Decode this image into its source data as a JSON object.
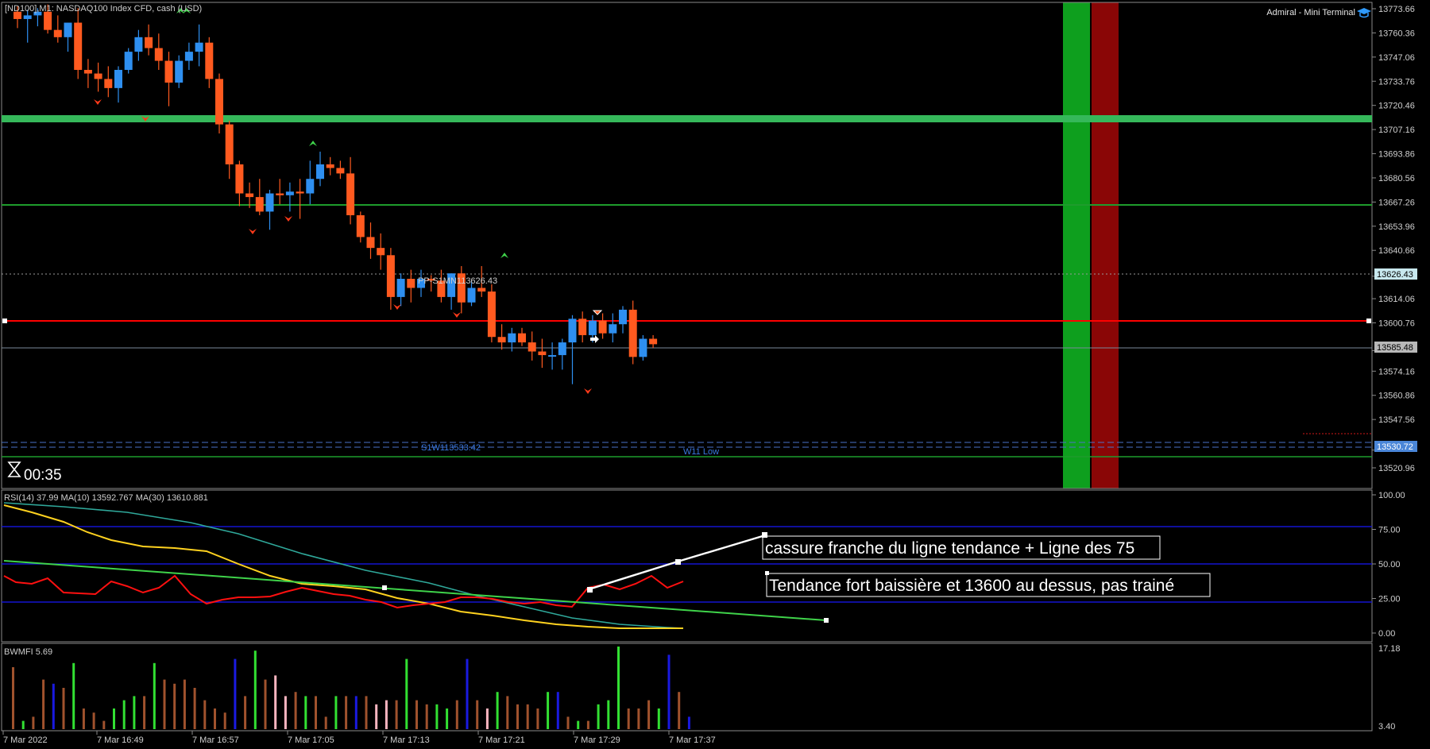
{
  "header": {
    "symbol_info": "[ND100],M1:  NASDAQ100 Index CFD, cash (USD)",
    "terminal_name": "Admiral - Mini Terminal"
  },
  "timer": {
    "value": "00:35"
  },
  "levels": {
    "pp": "PP-S1MN113626.43",
    "s1w": "S1W113533.42",
    "wl": "W11 Low"
  },
  "price_axis": {
    "labels": [
      "13773.66",
      "13760.36",
      "13747.06",
      "13733.76",
      "13720.46",
      "13707.16",
      "13693.86",
      "13680.56",
      "13667.26",
      "13653.96",
      "13640.66",
      "13626.43",
      "13614.06",
      "13600.76",
      "13585.48",
      "13574.16",
      "13560.86",
      "13547.56",
      "13530.72",
      "13520.96"
    ],
    "boxes": {
      "pivot": "13626.43",
      "current": "13585.48",
      "support": "13530.72"
    }
  },
  "rsi": {
    "title": "RSI(14) 37.99 MA(10) 13592.767 MA(30) 13610.881",
    "axis_labels": [
      "100.00",
      "75.00",
      "50.00",
      "25.00",
      "0.00"
    ]
  },
  "bwmfi": {
    "title": "BWMFI 5.69",
    "axis_labels": [
      "17.18",
      "3.40"
    ]
  },
  "annotations": {
    "note1": "cassure franche du ligne tendance + Ligne des 75",
    "note2": "Tendance fort baissière et 13600 au dessus, pas trainé"
  },
  "time_axis": [
    "7 Mar 2022",
    "7 Mar 16:49",
    "7 Mar 16:57",
    "7 Mar 17:05",
    "7 Mar 17:13",
    "7 Mar 17:21",
    "7 Mar 17:29",
    "7 Mar 17:37"
  ],
  "colors": {
    "bull": "#2e8ff0",
    "bear": "#ff5a1f",
    "resistance_line": "#ff0000",
    "rsi_line": "#ff1010",
    "ma_fast": "#ffd21f",
    "ma_slow": "#2fa89a",
    "trendline": "#3fd34a",
    "zone_green": "#0e9f1e",
    "zone_red": "#8a0606"
  },
  "chart_data": {
    "type": "candlestick",
    "series": [
      {
        "name": "",
        "ohlc": [
          [
            13772,
            13775,
            13763,
            13768
          ],
          [
            13768,
            13773,
            13755,
            13770
          ],
          [
            13770,
            13774,
            13764,
            13772
          ],
          [
            13772,
            13776,
            13760,
            13762
          ],
          [
            13762,
            13770,
            13755,
            13758
          ],
          [
            13758,
            13766,
            13750,
            13766
          ],
          [
            13766,
            13774,
            13735,
            13740
          ],
          [
            13740,
            13746,
            13730,
            13738
          ],
          [
            13738,
            13744,
            13728,
            13735
          ],
          [
            13735,
            13742,
            13725,
            13730
          ],
          [
            13730,
            13742,
            13722,
            13740
          ],
          [
            13740,
            13752,
            13738,
            13750
          ],
          [
            13750,
            13762,
            13745,
            13758
          ],
          [
            13758,
            13765,
            13748,
            13752
          ],
          [
            13752,
            13760,
            13740,
            13745
          ],
          [
            13745,
            13750,
            13720,
            13733
          ],
          [
            13733,
            13748,
            13730,
            13745
          ],
          [
            13745,
            13755,
            13740,
            13750
          ],
          [
            13750,
            13765,
            13742,
            13755
          ],
          [
            13755,
            13758,
            13730,
            13735
          ],
          [
            13735,
            13738,
            13705,
            13710
          ],
          [
            13710,
            13712,
            13680,
            13688
          ],
          [
            13688,
            13690,
            13665,
            13672
          ],
          [
            13672,
            13678,
            13664,
            13670
          ],
          [
            13670,
            13680,
            13660,
            13662
          ],
          [
            13662,
            13674,
            13652,
            13672
          ],
          [
            13672,
            13680,
            13666,
            13671
          ],
          [
            13671,
            13678,
            13662,
            13673
          ],
          [
            13673,
            13680,
            13658,
            13672
          ],
          [
            13672,
            13690,
            13666,
            13680
          ],
          [
            13680,
            13695,
            13676,
            13688
          ],
          [
            13688,
            13692,
            13682,
            13686
          ],
          [
            13686,
            13690,
            13680,
            13683
          ],
          [
            13683,
            13692,
            13655,
            13660
          ],
          [
            13660,
            13662,
            13645,
            13648
          ],
          [
            13648,
            13656,
            13636,
            13642
          ],
          [
            13642,
            13650,
            13630,
            13638
          ],
          [
            13638,
            13642,
            13608,
            13615
          ],
          [
            13615,
            13628,
            13610,
            13625
          ],
          [
            13625,
            13630,
            13612,
            13620
          ],
          [
            13620,
            13630,
            13615,
            13625
          ],
          [
            13625,
            13627,
            13618,
            13624
          ],
          [
            13624,
            13630,
            13612,
            13615
          ],
          [
            13615,
            13628,
            13608,
            13628
          ],
          [
            13628,
            13632,
            13606,
            13612
          ],
          [
            13612,
            13624,
            13610,
            13620
          ],
          [
            13620,
            13632,
            13615,
            13618
          ],
          [
            13618,
            13622,
            13590,
            13593
          ],
          [
            13593,
            13600,
            13586,
            13590
          ],
          [
            13590,
            13598,
            13585,
            13595
          ],
          [
            13595,
            13598,
            13588,
            13590
          ],
          [
            13590,
            13596,
            13580,
            13585
          ],
          [
            13585,
            13592,
            13576,
            13583
          ],
          [
            13583,
            13590,
            13575,
            13583
          ],
          [
            13583,
            13592,
            13575,
            13590
          ],
          [
            13590,
            13605,
            13567,
            13603
          ],
          [
            13603,
            13607,
            13590,
            13594
          ],
          [
            13594,
            13605,
            13590,
            13602
          ],
          [
            13602,
            13606,
            13592,
            13595
          ],
          [
            13595,
            13606,
            13590,
            13600
          ],
          [
            13600,
            13610,
            13595,
            13608
          ],
          [
            13608,
            13613,
            13578,
            13582
          ],
          [
            13582,
            13594,
            13580,
            13592
          ],
          [
            13592,
            13594,
            13587,
            13589
          ]
        ]
      }
    ],
    "horizontal_levels": [
      13711.5,
      13665.5,
      13626.43,
      13600.76,
      13585.48,
      13533.42,
      13530.72
    ],
    "rsi_ylim": [
      0,
      100
    ],
    "x": [
      "7 Mar 2022",
      "7 Mar 16:49",
      "7 Mar 16:57",
      "7 Mar 17:05",
      "7 Mar 17:13",
      "7 Mar 17:21",
      "7 Mar 17:29",
      "7 Mar 17:37"
    ]
  }
}
